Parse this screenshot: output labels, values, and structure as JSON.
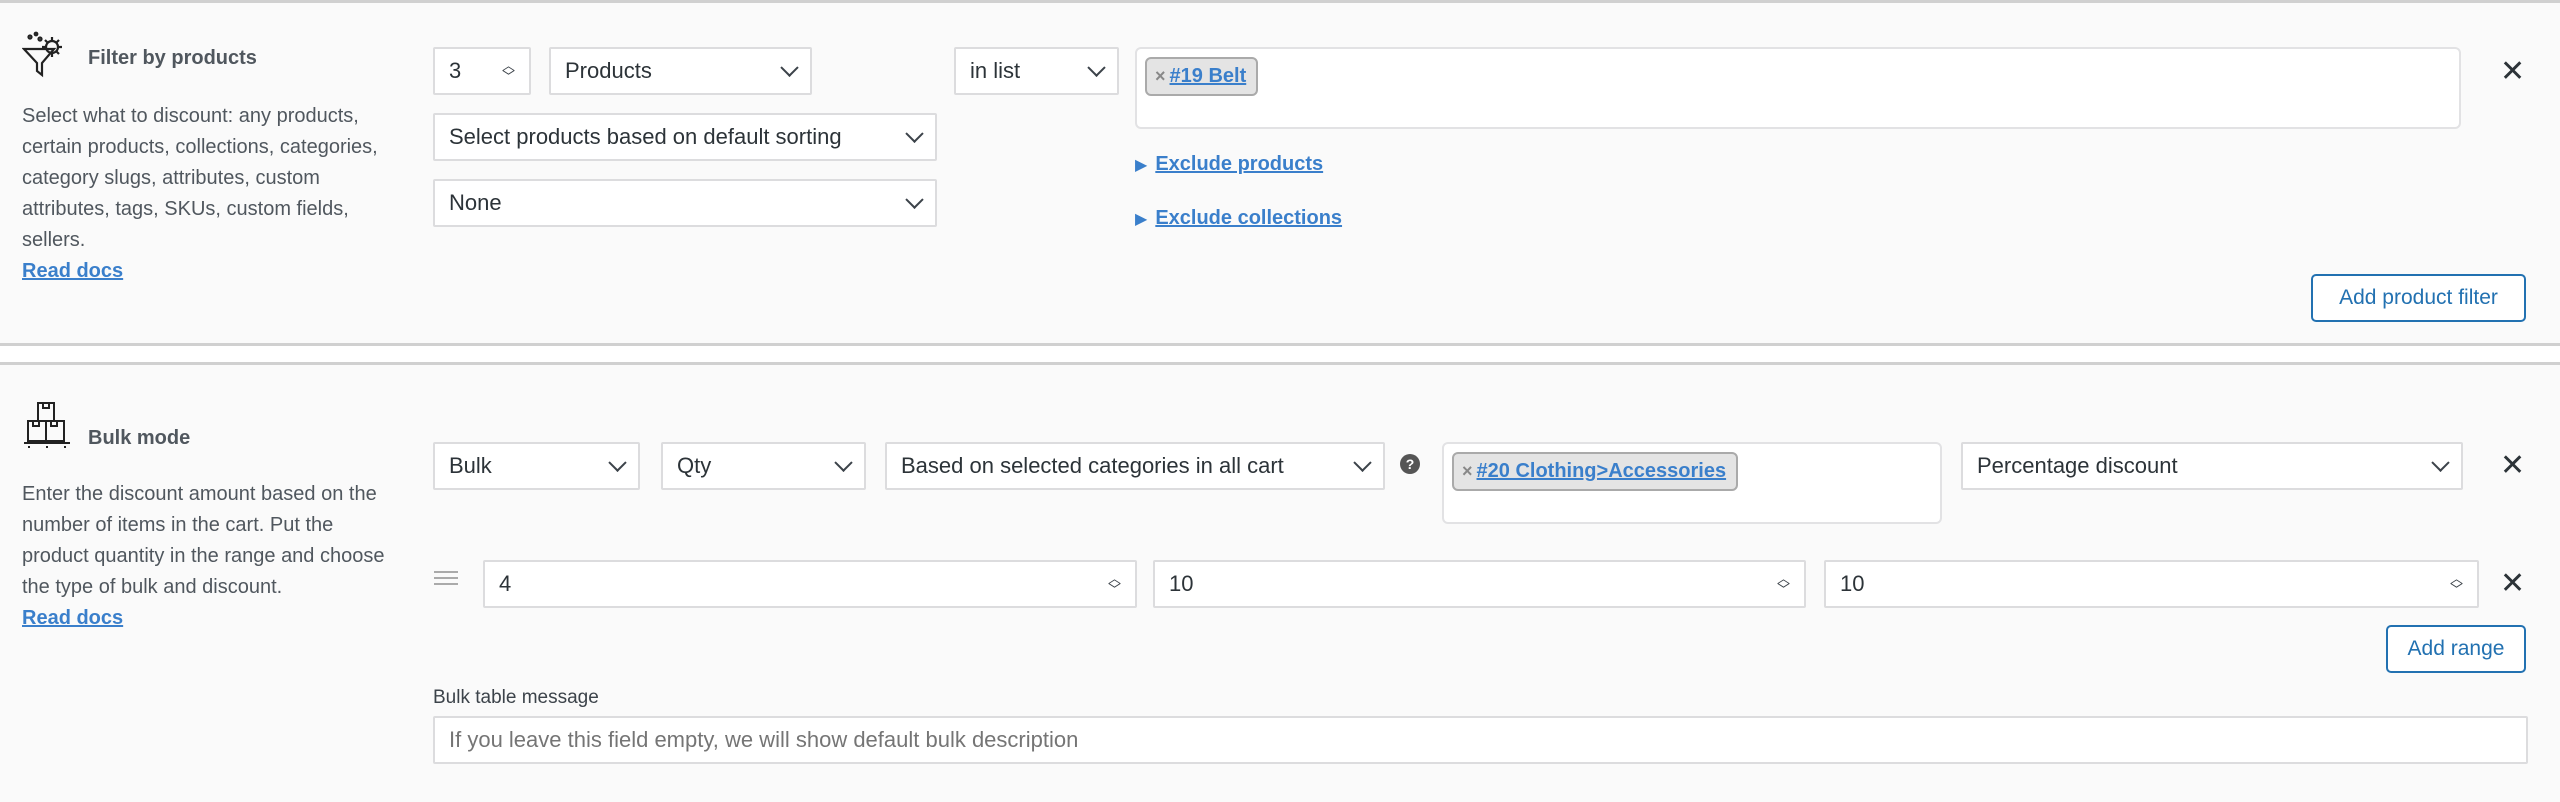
{
  "filter": {
    "title": "Filter by products",
    "description": "Select what to discount: any products, certain products, collections, categories, category slugs, attributes, custom attributes, tags, SKUs, custom fields, sellers.",
    "read_docs": "Read docs",
    "count_value": "3",
    "type_select": "Products",
    "condition_select": "in list",
    "sorting_select": "Select products based on default sorting",
    "extra_select": "None",
    "tags": [
      "#19 Belt"
    ],
    "exclude_products": "Exclude products",
    "exclude_collections": "Exclude collections",
    "add_button": "Add product filter",
    "close": "✕"
  },
  "bulk": {
    "title": "Bulk mode",
    "description": "Enter the discount amount based on the number of items in the cart. Put the product quantity in the range and choose the type of bulk and discount.",
    "read_docs": "Read docs",
    "mode_select": "Bulk",
    "measure_select": "Qty",
    "basis_select": "Based on selected categories in all cart",
    "help": "?",
    "tags": [
      "#20 Clothing>Accessories"
    ],
    "discount_select": "Percentage discount",
    "range": {
      "from": "4",
      "to": "10",
      "value": "10"
    },
    "add_range": "Add range",
    "table_message_label": "Bulk table message",
    "table_message_placeholder": "If you leave this field empty, we will show default bulk description",
    "close": "✕"
  }
}
